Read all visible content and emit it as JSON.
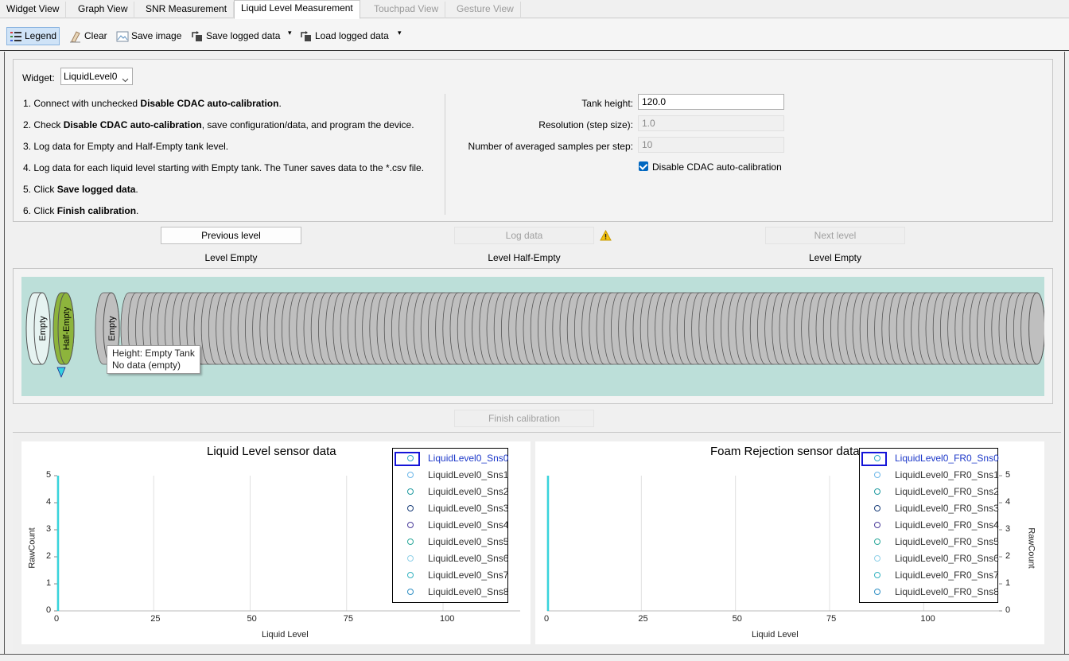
{
  "tabs": [
    {
      "label": "Widget View",
      "state": "normal"
    },
    {
      "label": "Graph View",
      "state": "normal"
    },
    {
      "label": "SNR Measurement",
      "state": "normal"
    },
    {
      "label": "Liquid Level Measurement",
      "state": "active"
    },
    {
      "label": "Touchpad View",
      "state": "disabled"
    },
    {
      "label": "Gesture View",
      "state": "disabled"
    }
  ],
  "toolbar": {
    "legend": "Legend",
    "clear": "Clear",
    "save_image": "Save image",
    "save_logged": "Save logged data",
    "load_logged": "Load logged data",
    "dropdown_glyph": "▾"
  },
  "config": {
    "widget_label": "Widget:",
    "widget_value": "LiquidLevel0",
    "steps": [
      [
        {
          "t": "1. Connect with unchecked "
        },
        {
          "t": "Disable CDAC auto-calibration",
          "b": true
        },
        {
          "t": "."
        }
      ],
      [
        {
          "t": "2. Check "
        },
        {
          "t": "Disable CDAC auto-calibration",
          "b": true
        },
        {
          "t": ", save configuration/data, and program the device."
        }
      ],
      [
        {
          "t": "3. Log data for Empty and Half-Empty tank level."
        }
      ],
      [
        {
          "t": "4. Log data for each liquid level starting with Empty tank. The Tuner saves data to the *.csv file."
        }
      ],
      [
        {
          "t": "5. Click "
        },
        {
          "t": "Save logged data",
          "b": true
        },
        {
          "t": "."
        }
      ],
      [
        {
          "t": "6. Click "
        },
        {
          "t": "Finish calibration",
          "b": true
        },
        {
          "t": "."
        }
      ]
    ],
    "tank_height_label": "Tank height:",
    "tank_height_value": "120.0",
    "resolution_label": "Resolution (step size):",
    "resolution_value": "1.0",
    "samples_label": "Number of averaged samples per step:",
    "samples_value": "10",
    "disable_cdac_label": "Disable CDAC auto-calibration",
    "disable_cdac_checked": true
  },
  "nav": {
    "previous": "Previous level",
    "log": "Log data",
    "next": "Next level",
    "warning_icon": "warning-icon",
    "prev_level": "Level Empty",
    "current_level": "Level Half-Empty",
    "next_level": "Level Empty",
    "finish": "Finish calibration"
  },
  "tank": {
    "cyl_empty": "Empty",
    "cyl_half": "Half-Empty",
    "cyl_step": "Empty",
    "tooltip_line1": "Height: Empty Tank",
    "tooltip_line2": "No data (empty)",
    "colors": {
      "bg": "#bcdfd9",
      "empty": "#e6f3f1",
      "half": "#8db43c",
      "gray": "#bfbfbf",
      "marker": "#33d1e0"
    }
  },
  "charts": [
    {
      "title": "Liquid Level sensor data",
      "ylabel": "RawCount",
      "xlabel": "Liquid Level",
      "xticks": [
        "0",
        "25",
        "50",
        "75",
        "100"
      ],
      "yticks": [
        "0",
        "1",
        "2",
        "3",
        "4",
        "5"
      ],
      "legend": [
        "LiquidLevel0_Sns0",
        "LiquidLevel0_Sns1",
        "LiquidLevel0_Sns2",
        "LiquidLevel0_Sns3",
        "LiquidLevel0_Sns4",
        "LiquidLevel0_Sns5",
        "LiquidLevel0_Sns6",
        "LiquidLevel0_Sns7",
        "LiquidLevel0_Sns8"
      ]
    },
    {
      "title": "Foam Rejection sensor data",
      "ylabel": "RawCount",
      "xlabel": "Liquid Level",
      "xticks": [
        "0",
        "25",
        "50",
        "75",
        "100"
      ],
      "yticks": [
        "0",
        "1",
        "2",
        "3",
        "4",
        "5"
      ],
      "legend": [
        "LiquidLevel0_FR0_Sns0",
        "LiquidLevel0_FR0_Sns1",
        "LiquidLevel0_FR0_Sns2",
        "LiquidLevel0_FR0_Sns3",
        "LiquidLevel0_FR0_Sns4",
        "LiquidLevel0_FR0_Sns5",
        "LiquidLevel0_FR0_Sns6",
        "LiquidLevel0_FR0_Sns7",
        "LiquidLevel0_FR0_Sns8"
      ]
    }
  ],
  "legend_colors": [
    "#2aa7c9",
    "#6ab6e8",
    "#1f9aa0",
    "#1b3f7a",
    "#4b3c9a",
    "#2aa89a",
    "#8fd0e8",
    "#33b2c0",
    "#2f8fc4"
  ],
  "chart_data": [
    {
      "type": "line",
      "title": "Liquid Level sensor data",
      "xlabel": "Liquid Level",
      "ylabel": "RawCount",
      "xlim": [
        0,
        120
      ],
      "ylim": [
        0,
        5
      ],
      "grid": true,
      "legend_position": "top-right",
      "series": [
        {
          "name": "LiquidLevel0_Sns0",
          "values": []
        },
        {
          "name": "LiquidLevel0_Sns1",
          "values": []
        },
        {
          "name": "LiquidLevel0_Sns2",
          "values": []
        },
        {
          "name": "LiquidLevel0_Sns3",
          "values": []
        },
        {
          "name": "LiquidLevel0_Sns4",
          "values": []
        },
        {
          "name": "LiquidLevel0_Sns5",
          "values": []
        },
        {
          "name": "LiquidLevel0_Sns6",
          "values": []
        },
        {
          "name": "LiquidLevel0_Sns7",
          "values": []
        },
        {
          "name": "LiquidLevel0_Sns8",
          "values": []
        }
      ]
    },
    {
      "type": "line",
      "title": "Foam Rejection sensor data",
      "xlabel": "Liquid Level",
      "ylabel": "RawCount",
      "xlim": [
        0,
        120
      ],
      "ylim": [
        0,
        5
      ],
      "grid": true,
      "legend_position": "top-right",
      "series": [
        {
          "name": "LiquidLevel0_FR0_Sns0",
          "values": []
        },
        {
          "name": "LiquidLevel0_FR0_Sns1",
          "values": []
        },
        {
          "name": "LiquidLevel0_FR0_Sns2",
          "values": []
        },
        {
          "name": "LiquidLevel0_FR0_Sns3",
          "values": []
        },
        {
          "name": "LiquidLevel0_FR0_Sns4",
          "values": []
        },
        {
          "name": "LiquidLevel0_FR0_Sns5",
          "values": []
        },
        {
          "name": "LiquidLevel0_FR0_Sns6",
          "values": []
        },
        {
          "name": "LiquidLevel0_FR0_Sns7",
          "values": []
        },
        {
          "name": "LiquidLevel0_FR0_Sns8",
          "values": []
        }
      ]
    }
  ]
}
